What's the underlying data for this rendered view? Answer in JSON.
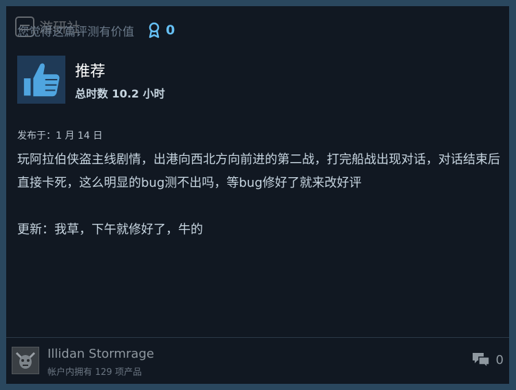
{
  "review": {
    "helpful_prompt": "您觉得这篇评测有价值",
    "award_count": "0",
    "recommendation": "推荐",
    "playtime": "总时数 10.2 小时",
    "posted": "发布于：1 月 14 日",
    "body": "玩阿拉伯侠盗主线剧情，出港向西北方向前进的第二战，打完船战出现对话，对话结束后直接卡死，这么明显的bug测不出吗，等bug修好了就来改好评\n\n更新：我草，下午就修好了，牛的"
  },
  "author": {
    "name": "Illidan Stormrage",
    "products": "帐户内拥有 129 项产品"
  },
  "comments": {
    "count": "0"
  },
  "icons": {
    "award": "award-ribbon-icon",
    "thumb": "thumbs-up-icon",
    "comment": "comment-bubble-icon",
    "avatar": "demon-skull-avatar"
  },
  "colors": {
    "background": "#2a475e",
    "card": "#111822",
    "accent": "#66c0f4",
    "thumb_box": "#1f3a57"
  }
}
